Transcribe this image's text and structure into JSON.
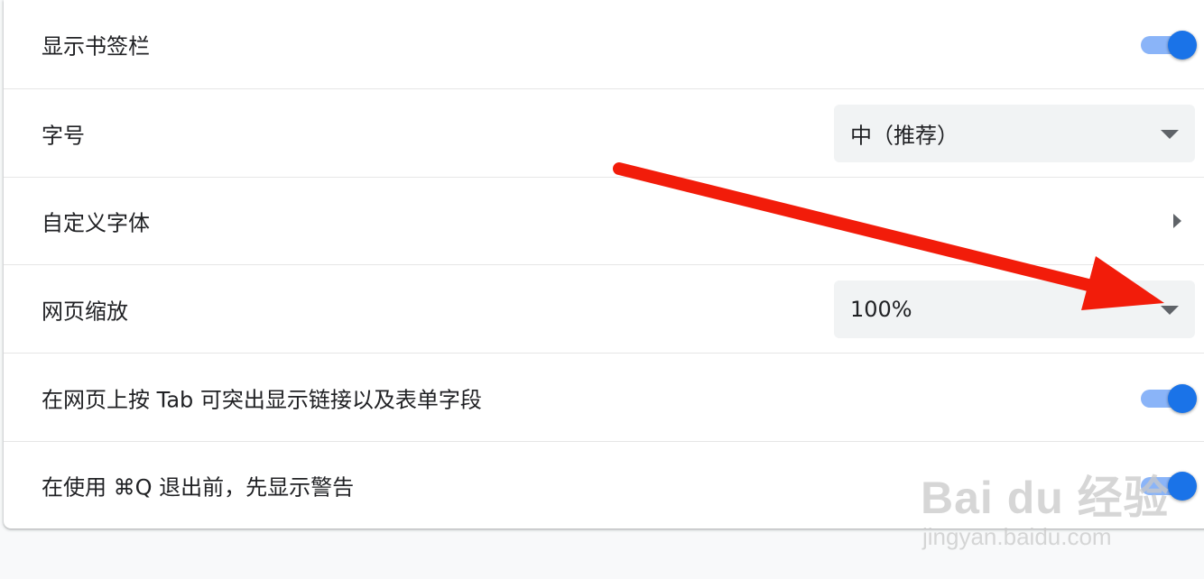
{
  "settings": {
    "show_bookmarks_bar": {
      "label": "显示书签栏",
      "enabled": true
    },
    "font_size": {
      "label": "字号",
      "value": "中（推荐）"
    },
    "custom_fonts": {
      "label": "自定义字体"
    },
    "page_zoom": {
      "label": "网页缩放",
      "value": "100%"
    },
    "tab_highlight": {
      "label": "在网页上按 Tab 可突出显示链接以及表单字段",
      "enabled": true
    },
    "quit_warning": {
      "label": "在使用 ⌘Q 退出前，先显示警告",
      "enabled": true
    }
  },
  "colors": {
    "toggle_on_knob": "#1a73e8",
    "toggle_on_track": "#8ab4f8",
    "annotation_arrow": "#f21c0a"
  },
  "watermark": {
    "logo": "Bai du 经验",
    "url": "jingyan.baidu.com"
  }
}
